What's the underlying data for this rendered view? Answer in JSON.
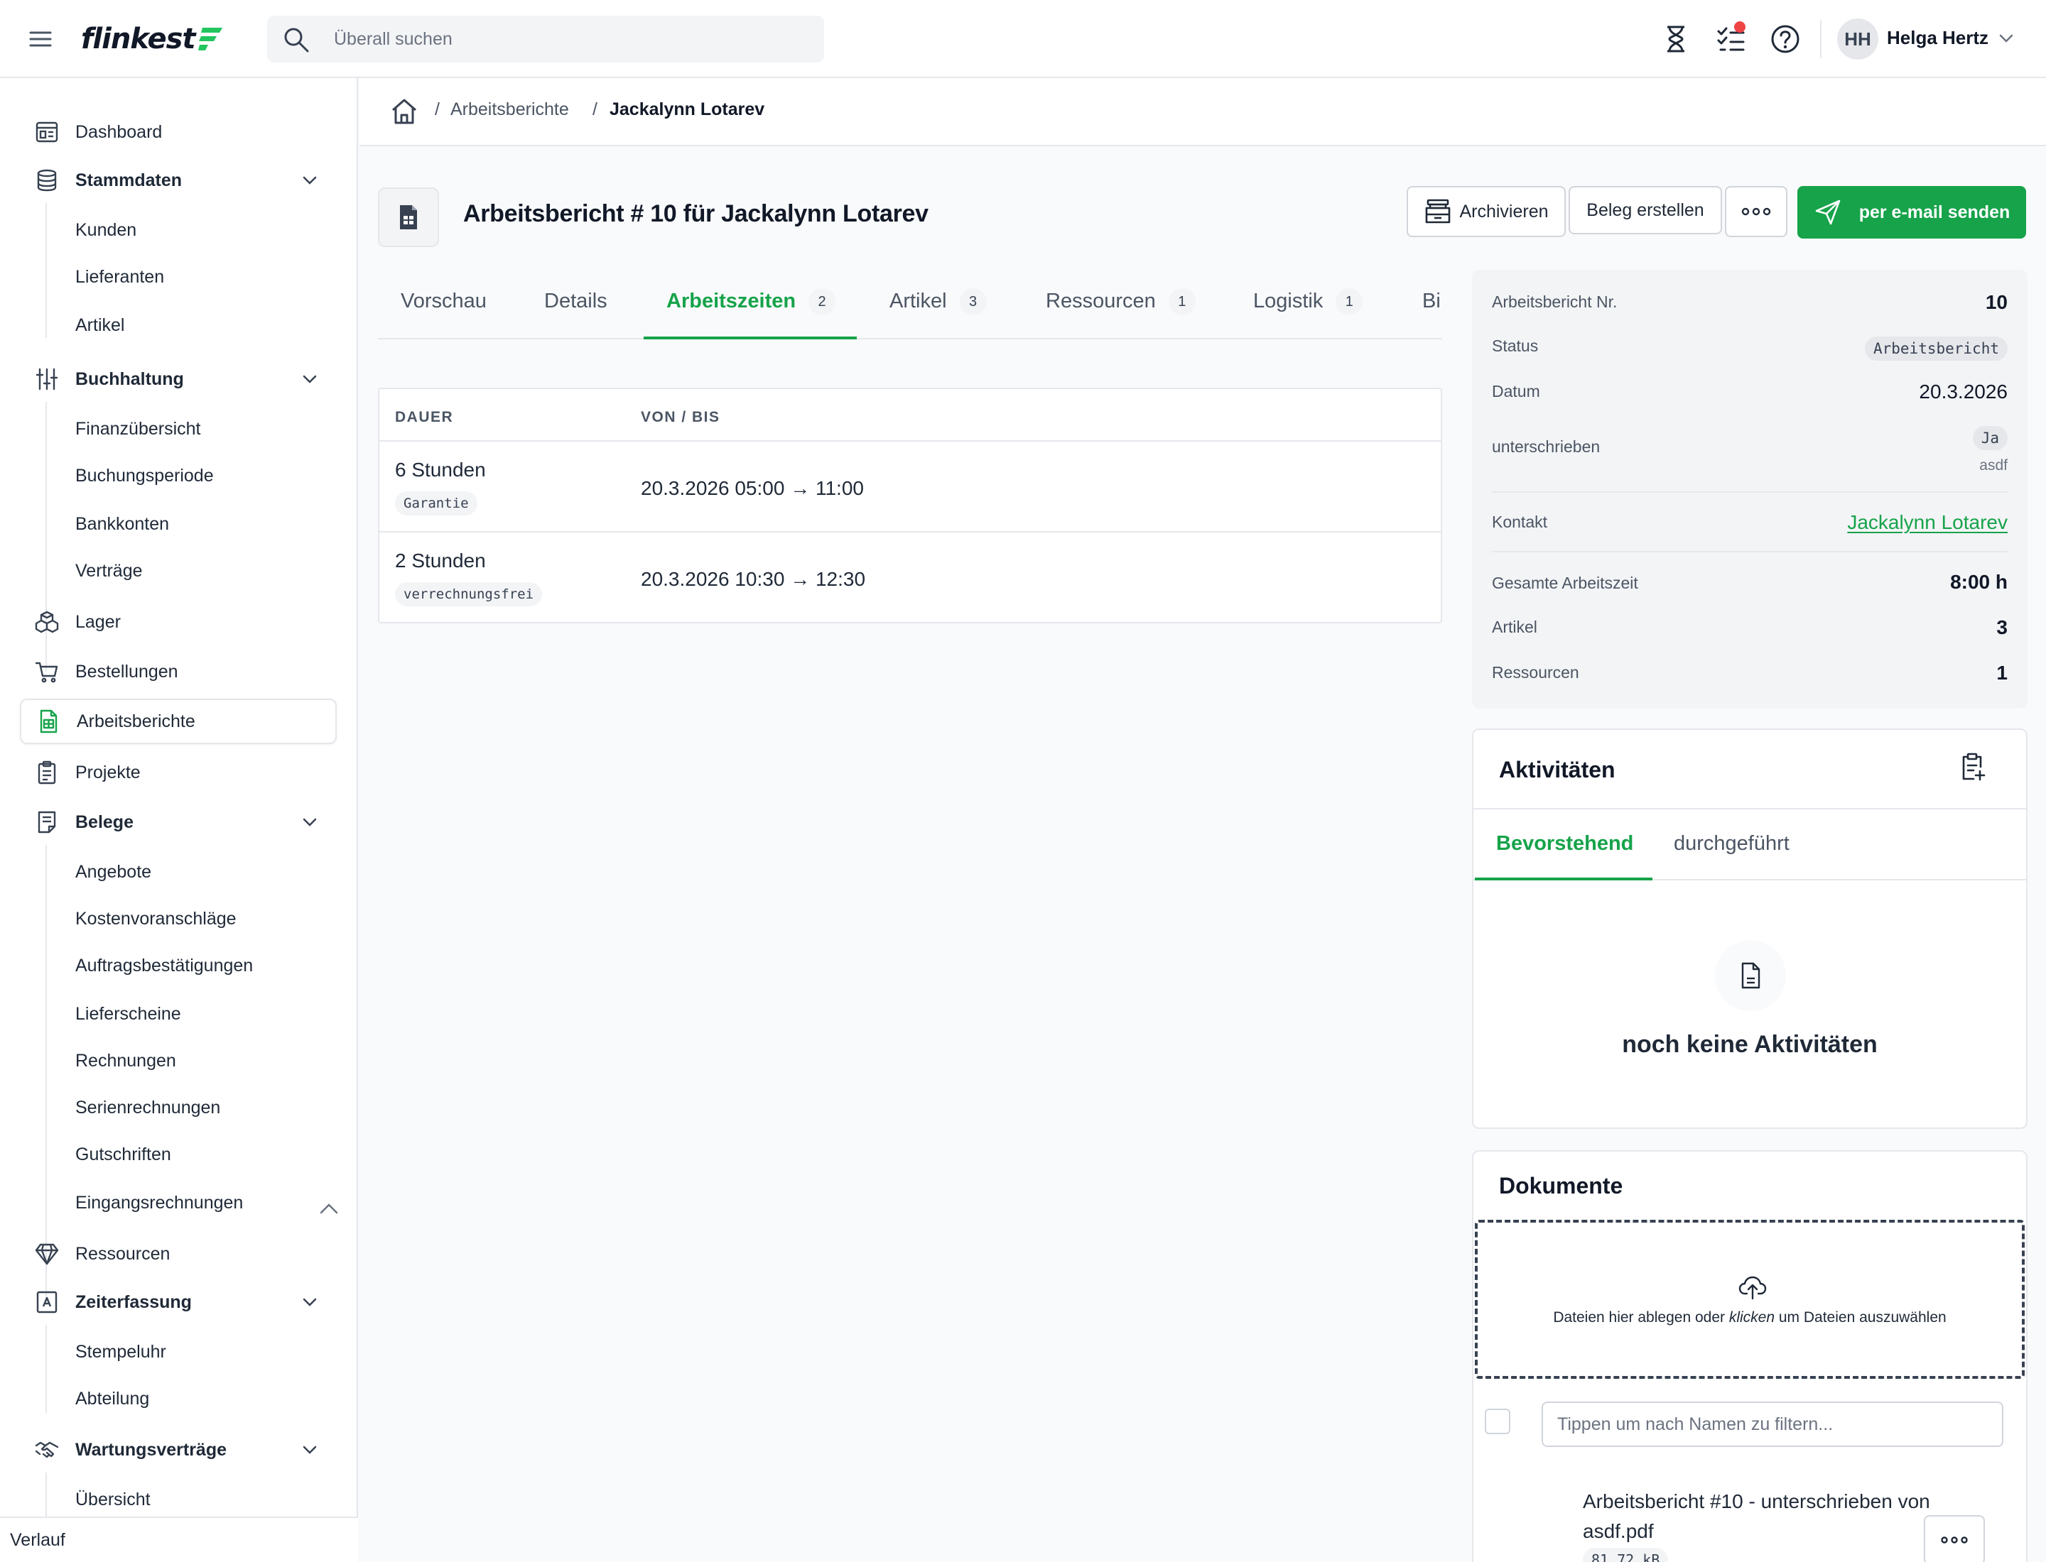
{
  "app": {
    "logo_text": "flinkest",
    "search_placeholder": "Überall suchen",
    "user_initials": "HH",
    "user_name": "Helga Hertz"
  },
  "colors": {
    "accent": "#16a34a",
    "notification": "#ef4444"
  },
  "sidebar": {
    "items": [
      {
        "label": "Dashboard",
        "icon": "dashboard-icon"
      },
      {
        "label": "Stammdaten",
        "icon": "database-icon",
        "expanded": true,
        "children": [
          "Kunden",
          "Lieferanten",
          "Artikel"
        ]
      },
      {
        "label": "Buchhaltung",
        "icon": "sliders-icon",
        "expanded": true,
        "children": [
          "Finanzübersicht",
          "Buchungsperiode",
          "Bankkonten",
          "Verträge"
        ]
      },
      {
        "label": "Lager",
        "icon": "boxes-icon"
      },
      {
        "label": "Bestellungen",
        "icon": "cart-icon"
      },
      {
        "label": "Arbeitsberichte",
        "icon": "report-icon",
        "active": true
      },
      {
        "label": "Projekte",
        "icon": "clipboard-icon"
      },
      {
        "label": "Belege",
        "icon": "receipt-icon",
        "expanded": true,
        "children": [
          "Angebote",
          "Kostenvoranschläge",
          "Auftragsbestätigungen",
          "Lieferscheine",
          "Rechnungen",
          "Serienrechnungen",
          "Gutschriften",
          "Eingangsrechnungen"
        ]
      },
      {
        "label": "Ressourcen",
        "icon": "gem-icon"
      },
      {
        "label": "Zeiterfassung",
        "icon": "time-icon",
        "expanded": true,
        "children": [
          "Stempeluhr",
          "Abteilung"
        ]
      },
      {
        "label": "Wartungsverträge",
        "icon": "handshake-icon",
        "expanded": true,
        "children": [
          "Übersicht"
        ]
      }
    ],
    "footer": "Verlauf"
  },
  "breadcrumb": [
    "Arbeitsberichte",
    "Jackalynn Lotarev"
  ],
  "page": {
    "title": "Arbeitsbericht # 10 für Jackalynn Lotarev",
    "buttons": {
      "archive": "Archivieren",
      "create_receipt": "Beleg erstellen",
      "send_email": "per e-mail senden"
    }
  },
  "tabs": [
    {
      "label": "Vorschau"
    },
    {
      "label": "Details"
    },
    {
      "label": "Arbeitszeiten",
      "count": "2",
      "active": true
    },
    {
      "label": "Artikel",
      "count": "3"
    },
    {
      "label": "Ressourcen",
      "count": "1"
    },
    {
      "label": "Logistik",
      "count": "1"
    },
    {
      "label": "Bi"
    }
  ],
  "worktimes": {
    "columns": [
      "DAUER",
      "VON / BIS"
    ],
    "rows": [
      {
        "duration": "6 Stunden",
        "tag": "Garantie",
        "range": "20.3.2026 05:00 → 11:00"
      },
      {
        "duration": "2 Stunden",
        "tag": "verrechnungsfrei",
        "range": "20.3.2026 10:30 → 12:30"
      }
    ]
  },
  "info": {
    "number_label": "Arbeitsbericht Nr.",
    "number": "10",
    "status_label": "Status",
    "status": "Arbeitsbericht",
    "date_label": "Datum",
    "date": "20.3.2026",
    "signed_label": "unterschrieben",
    "signed": "Ja",
    "signed_by": "asdf",
    "contact_label": "Kontakt",
    "contact": "Jackalynn Lotarev",
    "total_label": "Gesamte Arbeitszeit",
    "total": "8:00 h",
    "articles_label": "Artikel",
    "articles": "3",
    "resources_label": "Ressourcen",
    "resources": "1"
  },
  "activities": {
    "title": "Aktivitäten",
    "tab_upcoming": "Bevorstehend",
    "tab_done": "durchgeführt",
    "empty": "noch keine Aktivitäten"
  },
  "documents": {
    "title": "Dokumente",
    "drop_before": "Dateien hier ablegen oder ",
    "drop_emph": "klicken",
    "drop_after": " um Dateien auszuwählen",
    "filter_placeholder": "Tippen um nach Namen zu filtern...",
    "file_name": "Arbeitsbericht #10 - unterschrieben von asdf.pdf",
    "file_size": "81.72 kB"
  }
}
